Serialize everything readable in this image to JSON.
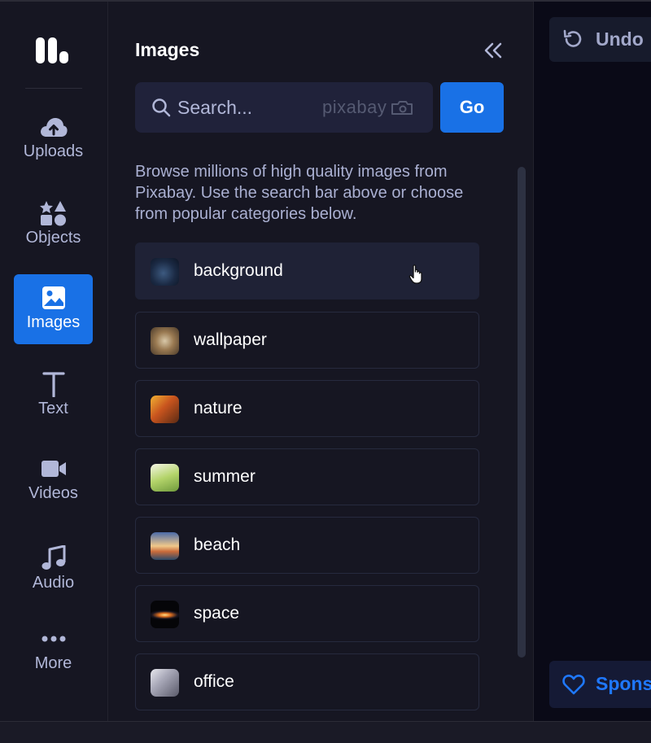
{
  "rail": {
    "items": [
      {
        "label": "Uploads",
        "icon": "cloud-upload-icon"
      },
      {
        "label": "Objects",
        "icon": "shapes-icon"
      },
      {
        "label": "Images",
        "icon": "image-icon",
        "active": true
      },
      {
        "label": "Text",
        "icon": "text-t-icon"
      },
      {
        "label": "Videos",
        "icon": "video-camera-icon"
      },
      {
        "label": "Audio",
        "icon": "music-note-icon"
      },
      {
        "label": "More",
        "icon": "more-dots-icon"
      }
    ]
  },
  "panel": {
    "title": "Images",
    "search_placeholder": "Search...",
    "provider_logo_text": "pixabay",
    "go_label": "Go",
    "description": "Browse millions of high quality images from Pixabay. Use the search bar above or choose from popular categories below.",
    "categories": [
      {
        "label": "background"
      },
      {
        "label": "wallpaper"
      },
      {
        "label": "nature"
      },
      {
        "label": "summer"
      },
      {
        "label": "beach"
      },
      {
        "label": "space"
      },
      {
        "label": "office"
      }
    ]
  },
  "canvas": {
    "undo_label": "Undo",
    "sponsor_label": "Spons"
  },
  "colors": {
    "accent": "#1971e6",
    "panel_bg": "#161622",
    "muted_text": "#b1b7d8"
  }
}
